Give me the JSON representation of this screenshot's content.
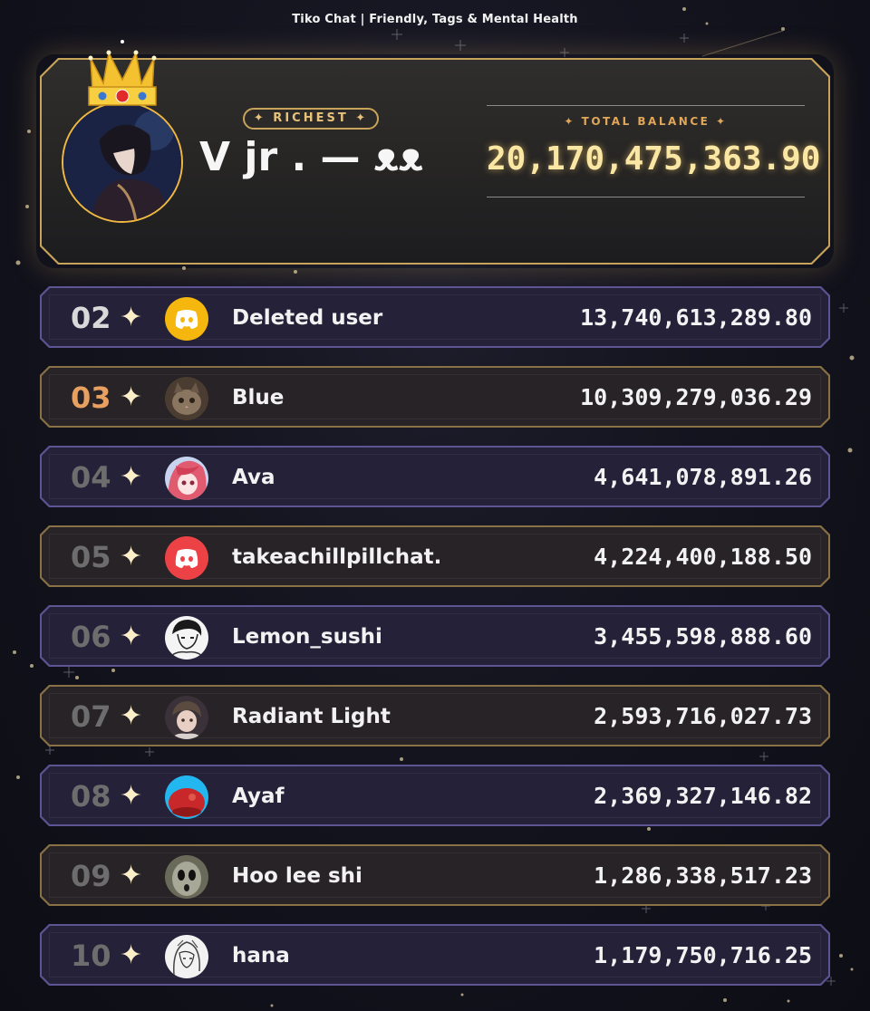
{
  "header": {
    "title": "Tiko Chat | Friendly, Tags & Mental Health"
  },
  "top": {
    "badge": "✦ RICHEST ✦",
    "name": "V jr . — ᴥᴥ",
    "balance_label": "✦  TOTAL BALANCE  ✦",
    "balance": "20,170,475,363.90"
  },
  "rows": [
    {
      "rank": "02",
      "name": "Deleted user",
      "amount": "13,740,613,289.80",
      "avatar": "discord-logo-yellow-icon",
      "color": "#f5b60d"
    },
    {
      "rank": "03",
      "name": "Blue",
      "amount": "10,309,279,036.29",
      "avatar": "cat-photo-avatar",
      "color": "#5a4a3a"
    },
    {
      "rank": "04",
      "name": "Ava",
      "amount": "4,641,078,891.26",
      "avatar": "anime-pink-hair-avatar",
      "color": "#e05a70"
    },
    {
      "rank": "05",
      "name": "takeachillpillchat.",
      "amount": "4,224,400,188.50",
      "avatar": "discord-logo-red-icon",
      "color": "#ed4245"
    },
    {
      "rank": "06",
      "name": "Lemon_sushi",
      "amount": "3,455,598,888.60",
      "avatar": "manga-sketch-avatar",
      "color": "#ffffff"
    },
    {
      "rank": "07",
      "name": "Radiant Light",
      "amount": "2,593,716,027.73",
      "avatar": "anime-boy-avatar",
      "color": "#6a5a52"
    },
    {
      "rank": "08",
      "name": "Ayaf",
      "amount": "2,369,327,146.82",
      "avatar": "red-beret-avatar",
      "color": "#22b7ef"
    },
    {
      "rank": "09",
      "name": "Hoo lee shi",
      "amount": "1,286,338,517.23",
      "avatar": "creepy-face-avatar",
      "color": "#8a8a7a"
    },
    {
      "rank": "10",
      "name": "hana",
      "amount": "1,179,750,716.25",
      "avatar": "sketch-girl-avatar",
      "color": "#f0f0f0"
    }
  ]
}
